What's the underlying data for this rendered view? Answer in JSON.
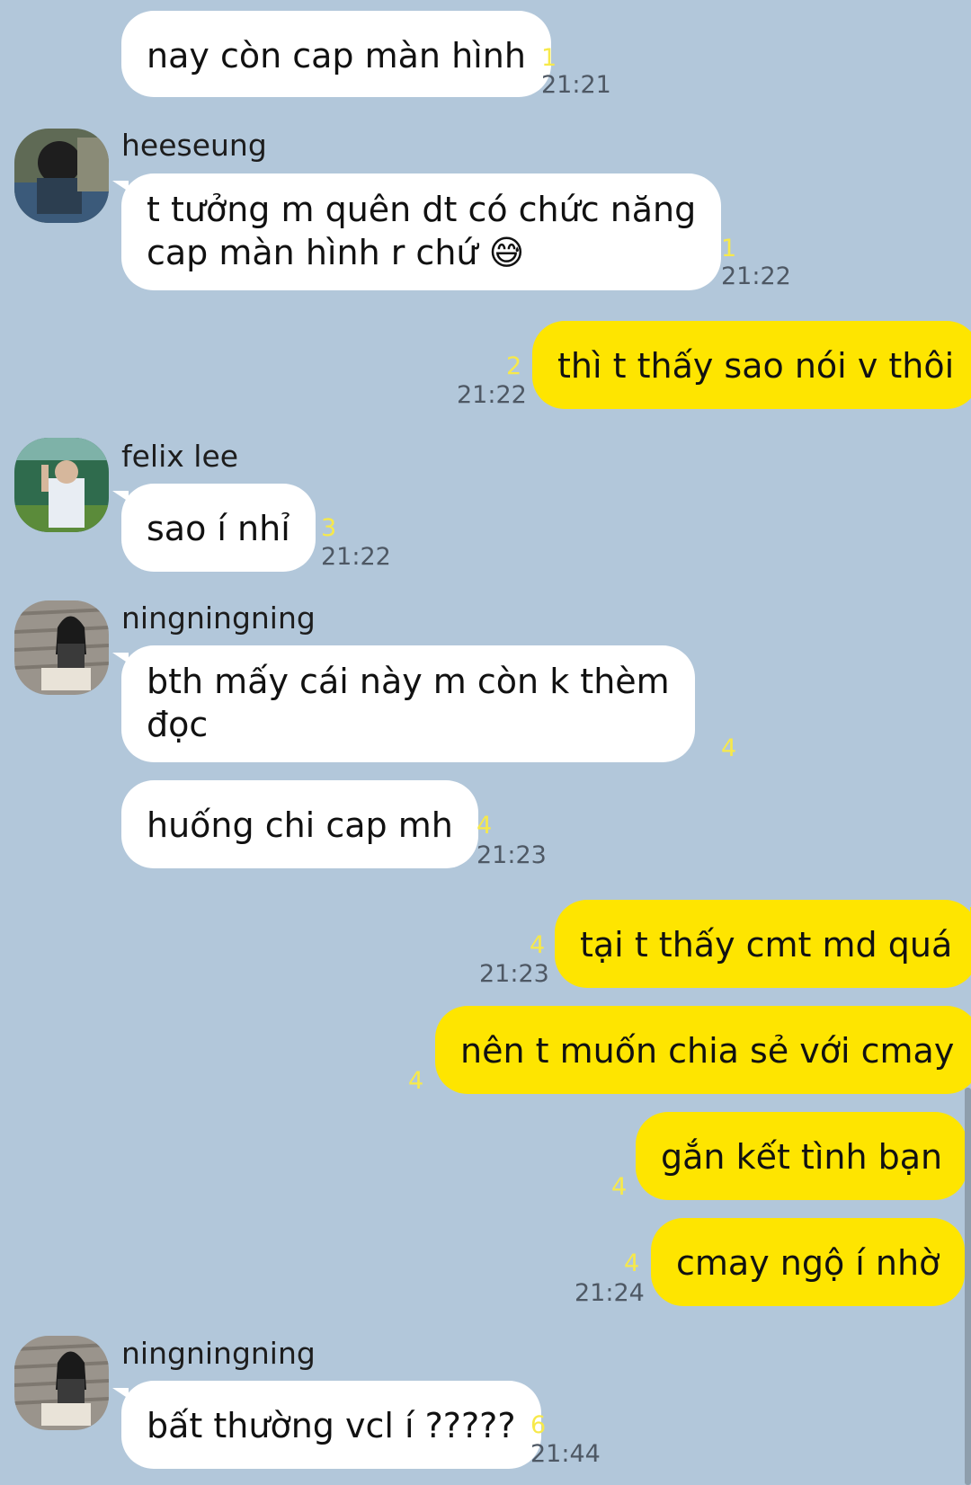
{
  "colors": {
    "background": "#b2c7da",
    "incoming_bubble": "#ffffff",
    "outgoing_bubble": "#fee500",
    "unread_count": "#f7e94a",
    "time": "#4e5864"
  },
  "messages": [
    {
      "text": "nay còn cap màn hình",
      "unread": "1",
      "time": "21:21"
    },
    {
      "sender": "heeseung",
      "text_line1": "t tưởng m quên dt có chức năng",
      "text_line2": "cap màn hình r chứ 😅",
      "unread": "1",
      "time": "21:22"
    },
    {
      "text": "thì t thấy sao nói v thôi",
      "unread": "2",
      "time": "21:22"
    },
    {
      "sender": "felix lee",
      "text": "sao í nhỉ",
      "unread": "3",
      "time": "21:22"
    },
    {
      "sender": "ningningning",
      "text_line1": "bth mấy cái này m còn k thèm",
      "text_line2": "đọc",
      "unread": "4"
    },
    {
      "text": "huống chi cap mh",
      "unread": "4",
      "time": "21:23"
    },
    {
      "text": "tại t thấy cmt md quá",
      "unread": "4",
      "time": "21:23"
    },
    {
      "text": "nên t muốn chia sẻ với cmay",
      "unread": "4"
    },
    {
      "text": "gắn kết tình bạn",
      "unread": "4"
    },
    {
      "text": "cmay ngộ í nhờ",
      "unread": "4",
      "time": "21:24"
    },
    {
      "sender": "ningningning",
      "text": "bất thường vcl í ?????",
      "unread": "6",
      "time": "21:44"
    }
  ]
}
